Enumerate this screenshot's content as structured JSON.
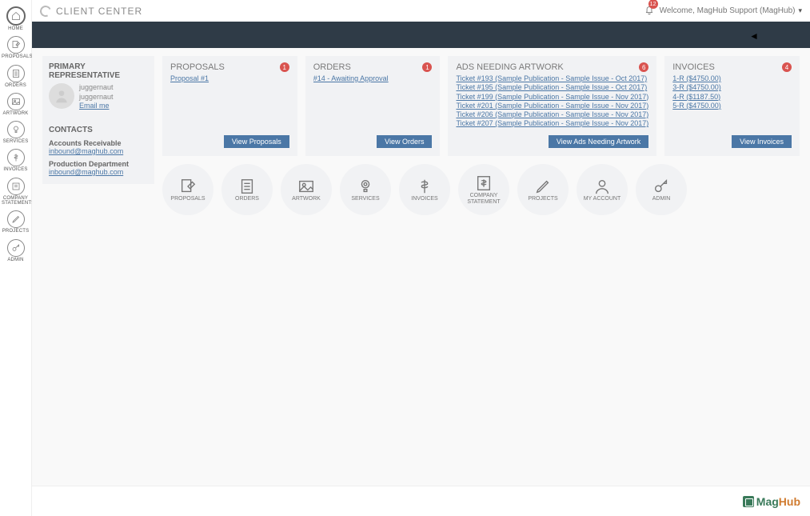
{
  "header": {
    "title": "CLIENT CENTER",
    "notification_count": "12",
    "welcome": "Welcome, MagHub Support (MagHub)"
  },
  "rail": {
    "items": [
      {
        "label": "HOME"
      },
      {
        "label": "PROPOSALS"
      },
      {
        "label": "ORDERS"
      },
      {
        "label": "ARTWORK"
      },
      {
        "label": "SERVICES"
      },
      {
        "label": "INVOICES"
      },
      {
        "label": "COMPANY STATEMENTS"
      },
      {
        "label": "PROJECTS"
      },
      {
        "label": "ADMIN"
      }
    ]
  },
  "sidebar": {
    "rep_heading": "PRIMARY REPRESENTATIVE",
    "rep_name1": "juggernaut",
    "rep_name2": "juggernaut",
    "rep_email_label": "Email me",
    "contacts_heading": "CONTACTS",
    "contacts": [
      {
        "name": "Accounts Receivable",
        "email": "inbound@maghub.com"
      },
      {
        "name": "Production Department",
        "email": "inbound@maghub.com"
      }
    ]
  },
  "cards": {
    "proposals": {
      "title": "PROPOSALS",
      "count": "1",
      "items": [
        {
          "text": "Proposal #1"
        }
      ],
      "button": "View Proposals"
    },
    "orders": {
      "title": "ORDERS",
      "count": "1",
      "items": [
        {
          "text": "#14 - Awaiting Approval"
        }
      ],
      "button": "View Orders"
    },
    "ads": {
      "title": "ADS NEEDING ARTWORK",
      "count": "6",
      "items": [
        {
          "text": "Ticket #193 (Sample Publication - Sample Issue - Oct 2017)"
        },
        {
          "text": "Ticket #195 (Sample Publication - Sample Issue - Oct 2017)"
        },
        {
          "text": "Ticket #199 (Sample Publication - Sample Issue - Nov 2017)"
        },
        {
          "text": "Ticket #201 (Sample Publication - Sample Issue - Nov 2017)"
        },
        {
          "text": "Ticket #206 (Sample Publication - Sample Issue - Nov 2017)"
        },
        {
          "text": "Ticket #207 (Sample Publication - Sample Issue - Nov 2017)"
        }
      ],
      "button": "View Ads Needing Artwork"
    },
    "invoices": {
      "title": "INVOICES",
      "count": "4",
      "items": [
        {
          "text": "1-R ($4750.00)"
        },
        {
          "text": "3-R ($4750.00)"
        },
        {
          "text": "4-R ($1187.50)"
        },
        {
          "text": "5-R ($4750.00)"
        }
      ],
      "button": "View Invoices"
    }
  },
  "circles": [
    {
      "label": "PROPOSALS"
    },
    {
      "label": "ORDERS"
    },
    {
      "label": "ARTWORK"
    },
    {
      "label": "SERVICES"
    },
    {
      "label": "INVOICES"
    },
    {
      "label": "COMPANY STATEMENT"
    },
    {
      "label": "PROJECTS"
    },
    {
      "label": "MY ACCOUNT"
    },
    {
      "label": "ADMIN"
    }
  ],
  "footer": {
    "brand_a": "Mag",
    "brand_b": "Hub"
  }
}
